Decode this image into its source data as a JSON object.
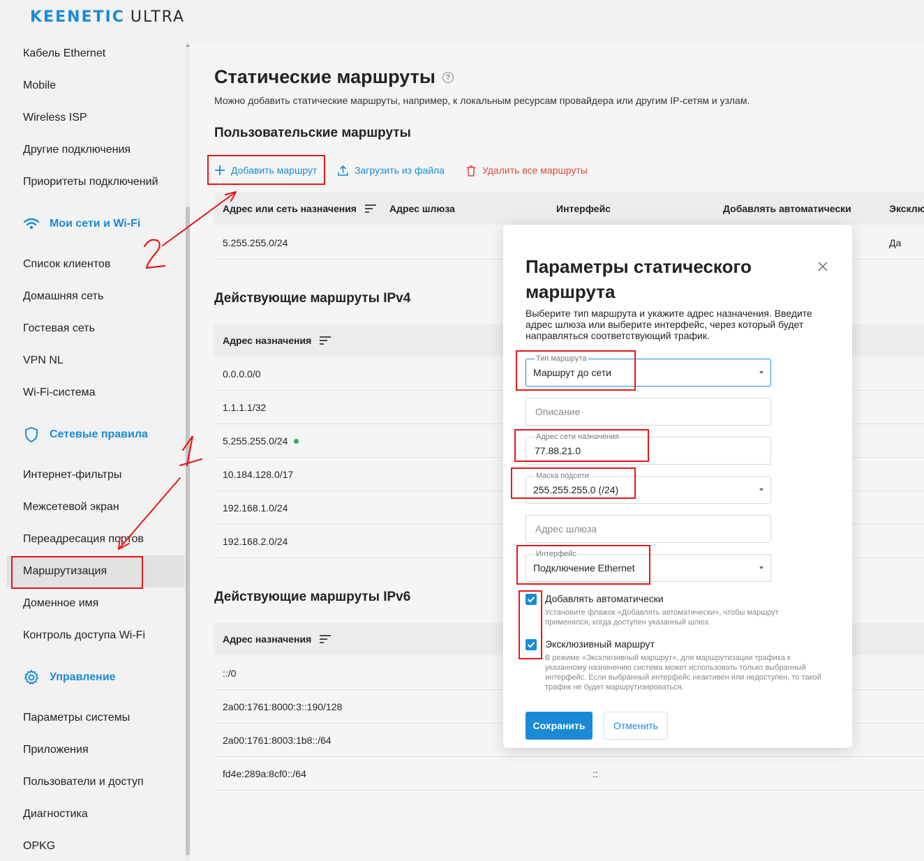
{
  "header": {
    "brand": "KEENETIC",
    "model": "ULTRA"
  },
  "sidebar": {
    "items_top": [
      "Кабель Ethernet",
      "Mobile",
      "Wireless ISP",
      "Другие подключения",
      "Приоритеты подключений"
    ],
    "section_wifi": "Мои сети и Wi-Fi",
    "items_wifi": [
      "Список клиентов",
      "Домашняя сеть",
      "Гостевая сеть",
      "VPN NL",
      "Wi-Fi-система"
    ],
    "section_rules": "Сетевые правила",
    "items_rules": [
      "Интернет-фильтры",
      "Межсетевой экран",
      "Переадресация портов",
      "Маршрутизация",
      "Доменное имя",
      "Контроль доступа Wi-Fi"
    ],
    "section_manage": "Управление",
    "items_manage": [
      "Параметры системы",
      "Приложения",
      "Пользователи и доступ",
      "Диагностика",
      "OPKG"
    ]
  },
  "page": {
    "title": "Статические маршруты",
    "help": "?",
    "description": "Можно добавить статические маршруты, например, к локальным ресурсам провайдера или другим IP-сетям и узлам.",
    "user_routes_title": "Пользовательские маршруты",
    "toolbar": {
      "add": "Добавить маршрут",
      "upload": "Загрузить из файла",
      "delete_all": "Удалить все маршруты"
    },
    "user_routes_headers": [
      "Адрес или сеть назначения",
      "Адрес шлюза",
      "Интерфейс",
      "Добавлять автоматически",
      "Эксклю"
    ],
    "user_routes": [
      {
        "dest": "5.255.255.0/24",
        "exclusive": "Да"
      }
    ],
    "ipv4_title": "Действующие маршруты IPv4",
    "ipv4_header": "Адрес назначения",
    "ipv4_routes": [
      "0.0.0.0/0",
      "1.1.1.1/32",
      "5.255.255.0/24",
      "10.184.128.0/17",
      "192.168.1.0/24",
      "192.168.2.0/24"
    ],
    "ipv6_title": "Действующие маршруты IPv6",
    "ipv6_header": "Адрес назначения",
    "ipv6_routes": [
      "::/0",
      "2a00:1761:8000:3::190/128",
      "2a00:1761:8003:1b8::/64",
      "fd4e:289a:8cf0::/64"
    ],
    "ipv6_last_gateway": "::"
  },
  "modal": {
    "title": "Параметры статического маршрута",
    "description": "Выберите тип маршрута и укажите адрес назначения. Введите адрес шлюза или выберите интерфейс, через который будет направляться соответствующий трафик.",
    "route_type": {
      "label": "Тип маршрута",
      "value": "Маршрут до сети"
    },
    "description_field": {
      "placeholder": "Описание"
    },
    "dest_network": {
      "label": "Адрес сети назначения",
      "value": "77.88.21.0"
    },
    "subnet_mask": {
      "label": "Маска подсети",
      "value": "255.255.255.0 (/24)"
    },
    "gateway": {
      "placeholder": "Адрес шлюза"
    },
    "interface": {
      "label": "Интерфейс",
      "value": "Подключение Ethernet"
    },
    "auto_add": {
      "label": "Добавлять автоматически",
      "hint": "Установите флажок «Добавлять автоматически», чтобы маршрут применялся, когда доступен указанный шлюз.",
      "checked": true
    },
    "exclusive": {
      "label": "Эксклюзивный маршрут",
      "hint": "В режиме «Эксклюзивный маршрут», для маршрутизации трафика к указанному назначению система может использовать только выбранный интерфейс. Если выбранный интерфейс неактивен или недоступен, то такой трафик не будет маршрутизироваться.",
      "checked": true
    },
    "save": "Сохранить",
    "cancel": "Отменить"
  },
  "annotations": {
    "label_1": "1",
    "label_2": "2"
  },
  "colors": {
    "accent": "#1b8ad6",
    "danger": "#e0473a",
    "annotation": "#e8161a",
    "status_ok": "#2bb04a"
  }
}
